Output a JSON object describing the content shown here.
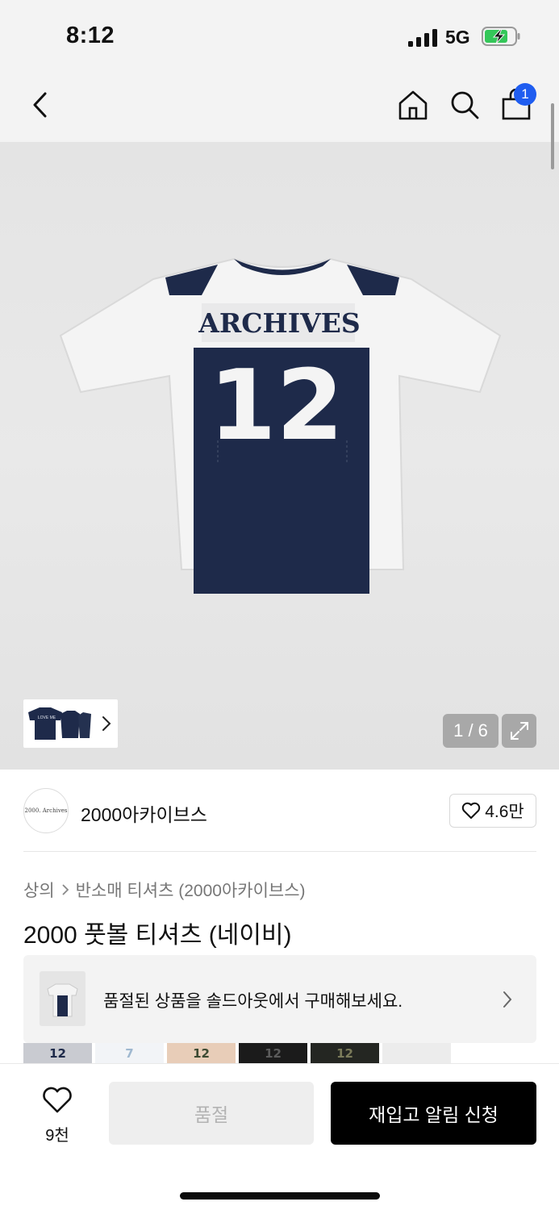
{
  "status_bar": {
    "time": "8:12",
    "network": "5G",
    "icons": [
      "signal-icon",
      "battery-charging-icon"
    ]
  },
  "nav": {
    "icons": [
      "back-chevron-icon",
      "home-icon",
      "search-icon",
      "shopping-bag-icon"
    ],
    "cart_count": "1"
  },
  "gallery": {
    "jersey_wordmark": "ARCHIVES",
    "jersey_number": "12",
    "counter": "1 / 6",
    "thumb_label": "LOVE ME",
    "icons": [
      "expand-icon",
      "chevron-right-icon"
    ]
  },
  "brand": {
    "logo_text": "2000. Archives",
    "name": "2000아카이브스",
    "likes": "4.6만"
  },
  "breadcrumb": {
    "items": [
      "상의",
      "반소매 티셔츠 (2000아카이브스)"
    ]
  },
  "product": {
    "title": "2000 풋볼 티셔츠 (네이비)"
  },
  "soldout_banner": {
    "text": "품절된 상품을 솔드아웃에서 구매해보세요."
  },
  "variants": [
    {
      "label": "12",
      "bg": "#c9cbd1",
      "fg": "#1e2a4a"
    },
    {
      "label": "7",
      "bg": "#f2f4f7",
      "fg": "#9fb8d0"
    },
    {
      "label": "12",
      "bg": "#e8cdb8",
      "fg": "#3c4a32"
    },
    {
      "label": "12",
      "bg": "#1b1b1b",
      "fg": "#5b5b5b"
    },
    {
      "label": "12",
      "bg": "#242622",
      "fg": "#7b7b5a"
    },
    {
      "label": "",
      "bg": "#ececec",
      "fg": "#d8a8a8"
    }
  ],
  "bottom_bar": {
    "wish_count": "9천",
    "soldout_label": "품절",
    "restock_label": "재입고 알림 신청"
  },
  "colors": {
    "accent_blue": "#1f5df0",
    "jersey_navy": "#1e2a4a",
    "jersey_white": "#f4f4f4"
  }
}
